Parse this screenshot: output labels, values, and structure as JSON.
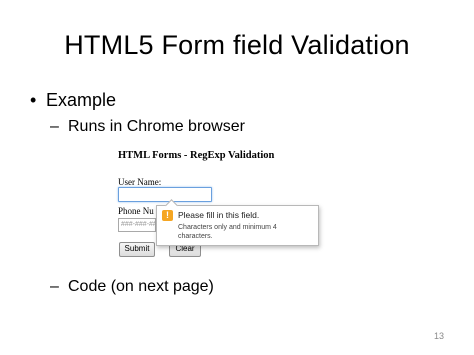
{
  "slide": {
    "title": "HTML5 Form field Validation",
    "bullet": "Example",
    "sub_bullet_1": "Runs in Chrome browser",
    "sub_bullet_2": "Code (on next page)",
    "bullet_marker": "•",
    "dash_marker": "–",
    "page_number": "13"
  },
  "demo": {
    "heading": "HTML Forms - RegExp Validation",
    "user_name_label": "User Name:",
    "user_name_value": "",
    "phone_label": "Phone Number:",
    "phone_placeholder": "###-###-####",
    "submit_label": "Submit",
    "clear_label": "Clear",
    "tooltip": {
      "icon": "warning-icon",
      "icon_glyph": "!",
      "icon_color": "#f5a623",
      "message": "Please fill in this field.",
      "detail": "Characters only and minimum 4 characters."
    }
  }
}
